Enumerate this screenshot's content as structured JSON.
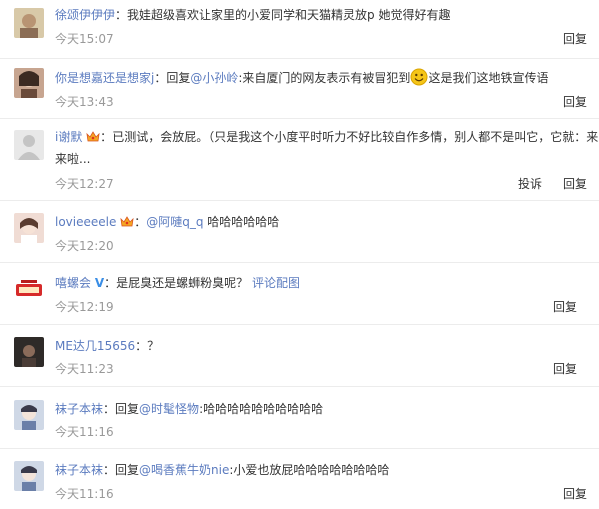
{
  "comments": [
    {
      "username": "徐颂伊伊伊",
      "separator": "：",
      "text": "我娃超级喜欢让家里的小爱同学和天猫精灵放p 她觉得好有趣",
      "time": "今天15:07",
      "reply_label": "回复"
    },
    {
      "username": "你是想嘉还是想家j",
      "separator": "：",
      "reply_prefix": "回复",
      "mention": "@小孙岭",
      "text_before_emoji": ":来自厦门的网友表示有被冒犯到",
      "text_after_emoji": "这是我们这地铁宣传语",
      "time": "今天13:43",
      "reply_label": "回复"
    },
    {
      "username": "i谢默",
      "separator": "：",
      "text_line1": "已测试，会放屁。（只是我这个小度平时听力不好比较自作多情，别人都不是叫它，它就：来",
      "text_line2": "来啦...",
      "time": "今天12:27",
      "report_label": "投诉",
      "reply_label": "回复"
    },
    {
      "username": "lovieeeele",
      "separator": "：",
      "mention": "@阿嗹q_q",
      "text": "哈哈哈哈哈哈",
      "time": "今天12:20",
      "reply_label": "回复"
    },
    {
      "username": "嘻螺会",
      "verified_mark": "V",
      "separator": "：",
      "text": "是屁臭还是螺蛳粉臭呢？",
      "extra_link": "评论配图",
      "time": "今天12:19",
      "reply_label": "回复"
    },
    {
      "username": "ME达几15656",
      "separator": "：",
      "text": "？",
      "time": "今天11:23",
      "reply_label": "回复"
    },
    {
      "username": "袜子本袜",
      "separator": "：",
      "reply_prefix": "回复",
      "mention": "@时髦怪物",
      "text": ":哈哈哈哈哈哈哈哈哈哈",
      "time": "今天11:16",
      "reply_label": "回复"
    },
    {
      "username": "袜子本袜",
      "separator": "：",
      "reply_prefix": "回复",
      "mention": "@喝香蕉牛奶nie",
      "text": ":小爱也放屁哈哈哈哈哈哈哈哈",
      "time": "今天11:16",
      "reply_label": "回复"
    }
  ],
  "colors": {
    "username": "#5b7bbf",
    "time": "#999999",
    "divider": "#ececec",
    "verified": "#3a8ee6"
  },
  "icons": {
    "crown": "vip-crown-icon",
    "emoji": "grinning-face-icon",
    "verified": "verified-v-icon"
  }
}
